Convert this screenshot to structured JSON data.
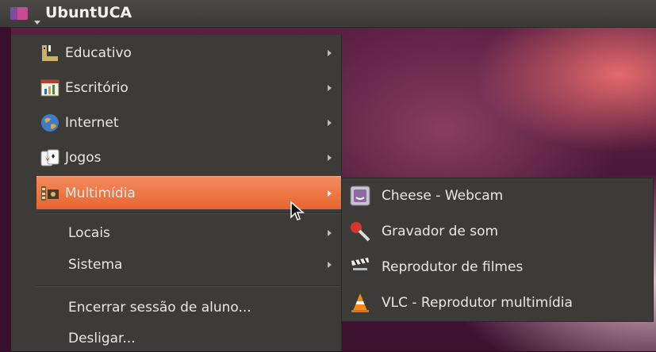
{
  "panel": {
    "title": "UbuntUCA"
  },
  "menu": {
    "categories": [
      {
        "label": "Educativo",
        "icon": "education-icon"
      },
      {
        "label": "Escritório",
        "icon": "office-icon"
      },
      {
        "label": "Internet",
        "icon": "globe-icon"
      },
      {
        "label": "Jogos",
        "icon": "cards-icon"
      },
      {
        "label": "Multimídia",
        "icon": "film-icon",
        "active": true
      }
    ],
    "places": [
      {
        "label": "Locais"
      },
      {
        "label": "Sistema"
      }
    ],
    "session": [
      {
        "label": "Encerrar sessão de aluno..."
      },
      {
        "label": "Desligar..."
      }
    ]
  },
  "submenu": {
    "items": [
      {
        "label": "Cheese - Webcam",
        "icon": "webcam-icon"
      },
      {
        "label": "Gravador de som",
        "icon": "microphone-icon"
      },
      {
        "label": "Reprodutor de filmes",
        "icon": "clapperboard-icon"
      },
      {
        "label": "VLC - Reprodutor multimídia",
        "icon": "vlc-cone-icon"
      }
    ]
  },
  "colors": {
    "highlight": "#e8652e",
    "menu_bg": "#3c3b37",
    "panel_bg": "#3b3a36"
  }
}
